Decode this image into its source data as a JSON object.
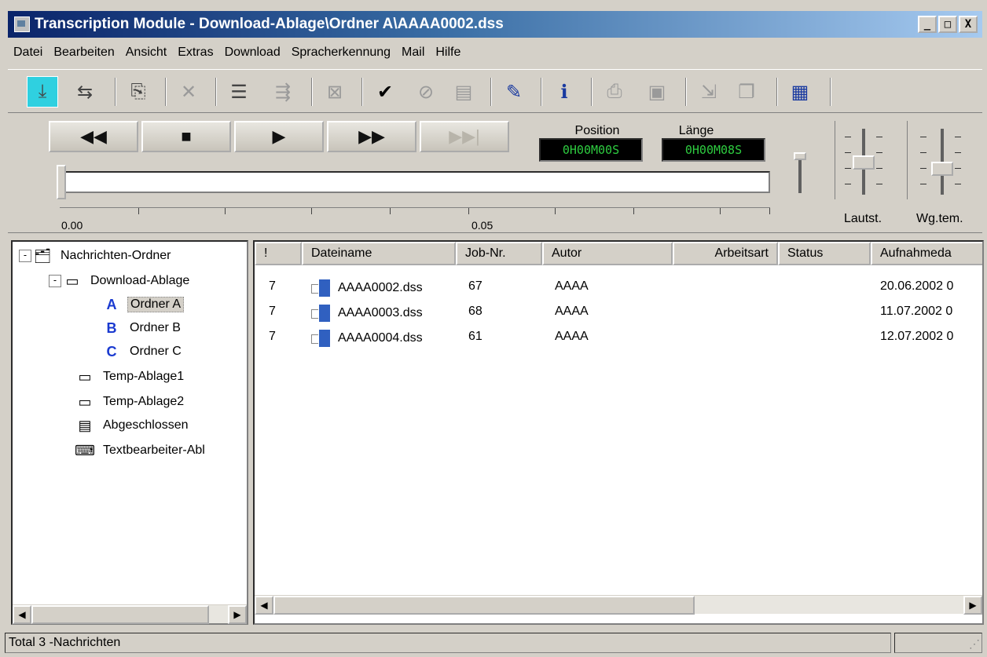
{
  "window": {
    "title": "Transcription Module - Download-Ablage\\Ordner A\\AAAA0002.dss",
    "buttons": {
      "minimize": "_",
      "maximize": "□",
      "close": "X"
    }
  },
  "menu": [
    "Datei",
    "Bearbeiten",
    "Ansicht",
    "Extras",
    "Download",
    "Spracherkennung",
    "Mail",
    "Hilfe"
  ],
  "toolbar": {
    "icons": [
      "download-icon",
      "arrows-icon",
      "import-icon",
      "delete-icon",
      "list-icon",
      "transfer-icon",
      "cancel-icon",
      "check-icon",
      "circle-check-icon",
      "form-icon",
      "edit-icon",
      "info-icon",
      "print-icon",
      "printer2-icon",
      "export-icon",
      "copy-icon",
      "properties-icon"
    ],
    "accent_active": "#2fd0e0"
  },
  "player": {
    "position_label": "Position",
    "position_value": "0H00M00S",
    "length_label": "Länge",
    "length_value": "0H00M08S",
    "scale_start": "0.00",
    "scale_mid": "0.05",
    "volume_label": "Lautst.",
    "speed_label": "Wg.tem.",
    "lcd_color": "#2ecc40"
  },
  "tree": {
    "root": "Nachrichten-Ordner",
    "items": [
      {
        "label": "Download-Ablage",
        "icon": "tray-icon"
      },
      {
        "label": "Ordner A",
        "icon": "folder-a-icon"
      },
      {
        "label": "Ordner B",
        "icon": "folder-b-icon"
      },
      {
        "label": "Ordner C",
        "icon": "folder-c-icon"
      },
      {
        "label": "Temp-Ablage1",
        "icon": "tray-icon"
      },
      {
        "label": "Temp-Ablage2",
        "icon": "tray-icon"
      },
      {
        "label": "Abgeschlossen",
        "icon": "archive-icon"
      },
      {
        "label": "Textbearbeiter-Abl",
        "icon": "typist-icon"
      }
    ],
    "selected": "Ordner A",
    "expand_minus": "-"
  },
  "list": {
    "headers": [
      "!",
      "Dateiname",
      "Job-Nr.",
      "Autor",
      "Arbeitsart",
      "Status",
      "Aufnahmeda"
    ],
    "rows": [
      {
        "priority": "7",
        "file": "AAAA0002.dss",
        "job": "67",
        "author": "AAAA",
        "worktype": "",
        "status": "",
        "date": "20.06.2002 0"
      },
      {
        "priority": "7",
        "file": "AAAA0003.dss",
        "job": "68",
        "author": "AAAA",
        "worktype": "",
        "status": "",
        "date": "11.07.2002 0"
      },
      {
        "priority": "7",
        "file": "AAAA0004.dss",
        "job": "61",
        "author": "AAAA",
        "worktype": "",
        "status": "",
        "date": "12.07.2002 0"
      }
    ]
  },
  "statusbar": {
    "text": "Total 3 -Nachrichten"
  }
}
